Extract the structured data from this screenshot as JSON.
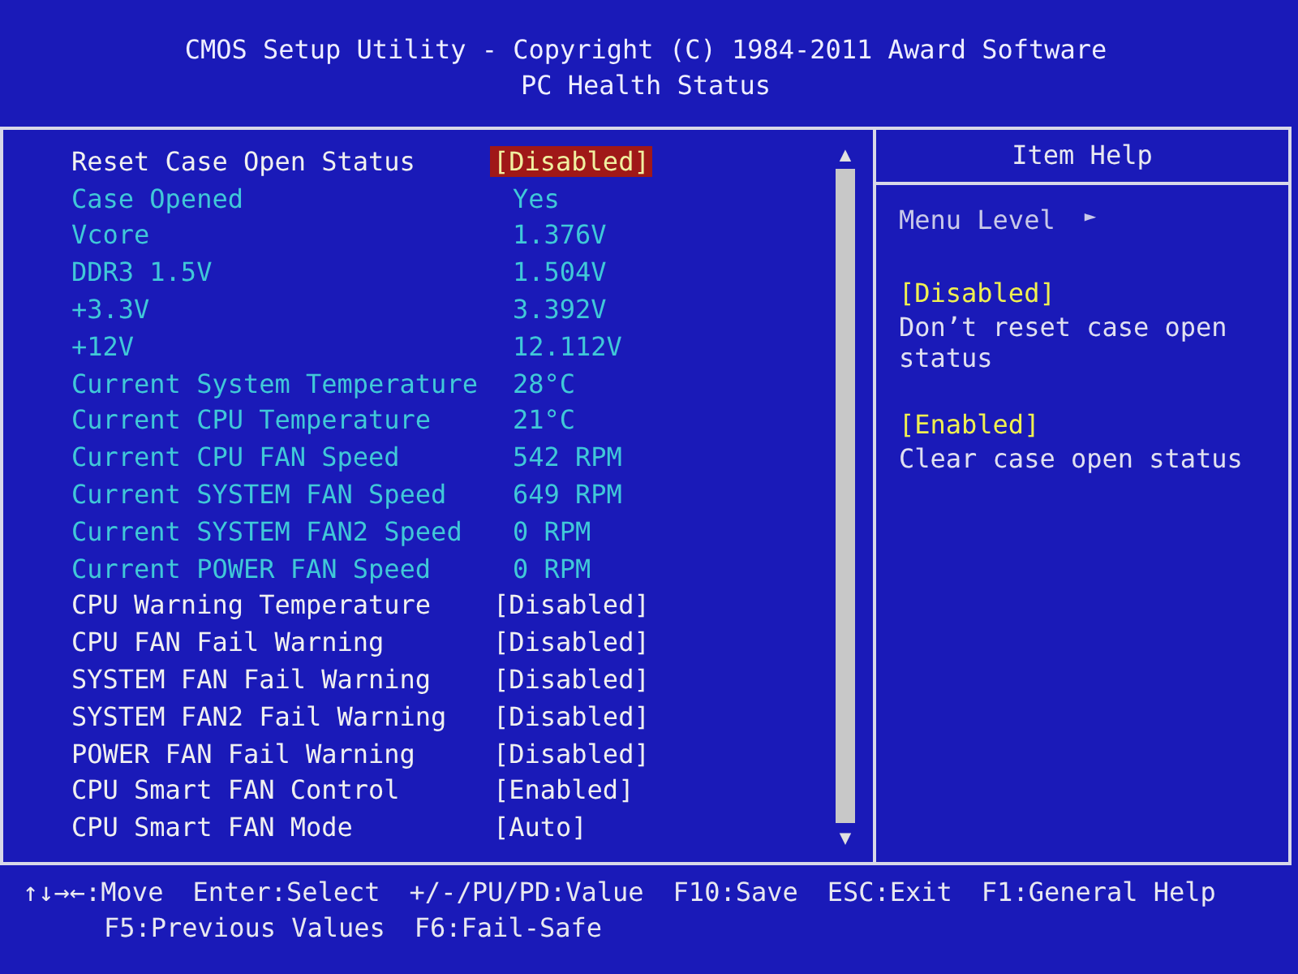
{
  "header": {
    "title": "CMOS Setup Utility - Copyright (C) 1984-2011 Award Software",
    "subtitle": "PC Health Status"
  },
  "settings": [
    {
      "label": "Reset Case Open Status",
      "value": "[Disabled]",
      "kind": "option",
      "selected": true
    },
    {
      "label": "Case Opened",
      "value": "Yes",
      "kind": "info",
      "selected": false
    },
    {
      "label": "Vcore",
      "value": "1.376V",
      "kind": "info",
      "selected": false
    },
    {
      "label": "DDR3 1.5V",
      "value": "1.504V",
      "kind": "info",
      "selected": false
    },
    {
      "label": "+3.3V",
      "value": "3.392V",
      "kind": "info",
      "selected": false
    },
    {
      "label": "+12V",
      "value": "12.112V",
      "kind": "info",
      "selected": false
    },
    {
      "label": "Current System Temperature",
      "value": "28°C",
      "kind": "info",
      "selected": false
    },
    {
      "label": "Current CPU Temperature",
      "value": "21°C",
      "kind": "info",
      "selected": false
    },
    {
      "label": "Current CPU FAN Speed",
      "value": "542 RPM",
      "kind": "info",
      "selected": false
    },
    {
      "label": "Current SYSTEM FAN Speed",
      "value": "649 RPM",
      "kind": "info",
      "selected": false
    },
    {
      "label": "Current SYSTEM FAN2 Speed",
      "value": "0 RPM",
      "kind": "info",
      "selected": false
    },
    {
      "label": "Current POWER FAN Speed",
      "value": "0 RPM",
      "kind": "info",
      "selected": false
    },
    {
      "label": "CPU Warning Temperature",
      "value": "[Disabled]",
      "kind": "option",
      "selected": false
    },
    {
      "label": "CPU FAN Fail Warning",
      "value": "[Disabled]",
      "kind": "option",
      "selected": false
    },
    {
      "label": "SYSTEM FAN Fail Warning",
      "value": "[Disabled]",
      "kind": "option",
      "selected": false
    },
    {
      "label": "SYSTEM FAN2 Fail Warning",
      "value": "[Disabled]",
      "kind": "option",
      "selected": false
    },
    {
      "label": "POWER FAN Fail Warning",
      "value": "[Disabled]",
      "kind": "option",
      "selected": false
    },
    {
      "label": "CPU Smart FAN Control",
      "value": "[Enabled]",
      "kind": "option",
      "selected": false
    },
    {
      "label": "CPU Smart FAN Mode",
      "value": "[Auto]",
      "kind": "option",
      "selected": false
    }
  ],
  "scrollbar": {
    "up": "▲",
    "down": "▼"
  },
  "help": {
    "title": "Item Help",
    "menu_level": "Menu Level",
    "menu_arrow": "►",
    "entries": [
      {
        "kind": "option",
        "text": "[Disabled]"
      },
      {
        "kind": "text",
        "text": "Don’t reset case open status"
      },
      {
        "kind": "option",
        "text": "[Enabled]"
      },
      {
        "kind": "text",
        "text": "Clear case open status"
      }
    ]
  },
  "footer": [
    [
      "↑↓→←:Move",
      "Enter:Select",
      "+/-/PU/PD:Value",
      "F10:Save",
      "ESC:Exit",
      "F1:General Help"
    ],
    [
      "F5:Previous Values",
      "F6:Fail-Safe"
    ]
  ]
}
